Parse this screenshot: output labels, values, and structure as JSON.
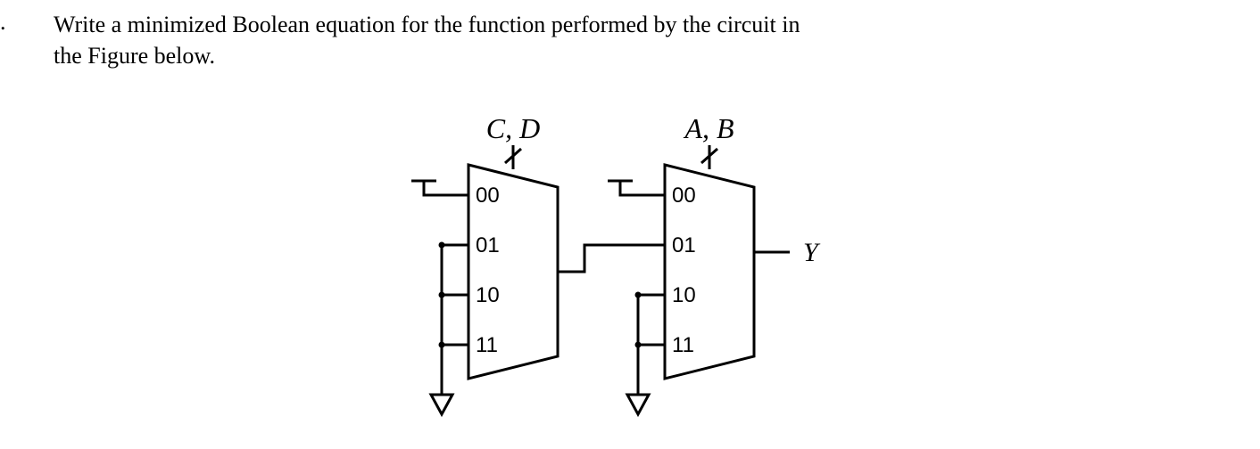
{
  "question": {
    "marker": ".",
    "line1": "Write a minimized Boolean equation for the function performed by the circuit in",
    "line2": "the Figure below."
  },
  "diagram": {
    "mux1": {
      "select_label": "C, D",
      "ports": [
        "00",
        "01",
        "10",
        "11"
      ]
    },
    "mux2": {
      "select_label": "A, B",
      "ports": [
        "00",
        "01",
        "10",
        "11"
      ]
    },
    "output_label": "Y"
  }
}
